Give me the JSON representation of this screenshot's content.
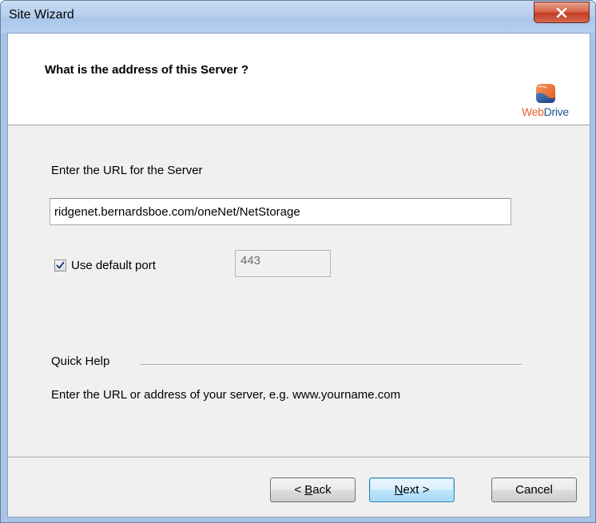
{
  "window": {
    "title": "Site Wizard",
    "close_label": "x"
  },
  "header": {
    "question": "What is the address of this Server ?",
    "logo_web": "Web",
    "logo_drive": "Drive"
  },
  "form": {
    "url_label": "Enter the URL for the Server",
    "url_value": "ridgenet.bernardsboe.com/oneNet/NetStorage",
    "use_default_port_label": "Use default port",
    "use_default_port_checked": true,
    "port_value": "443"
  },
  "quick_help": {
    "label": "Quick Help",
    "text": "Enter the URL or address of your server, e.g. www.yourname.com"
  },
  "buttons": {
    "back_prefix": "< ",
    "back_hotkey": "B",
    "back_rest": "ack",
    "next_hotkey": "N",
    "next_rest": "ext >",
    "cancel": "Cancel"
  },
  "colors": {
    "logo_orange": "#e8612c",
    "logo_blue": "#1f4f8f",
    "close_red": "#c33c22"
  }
}
